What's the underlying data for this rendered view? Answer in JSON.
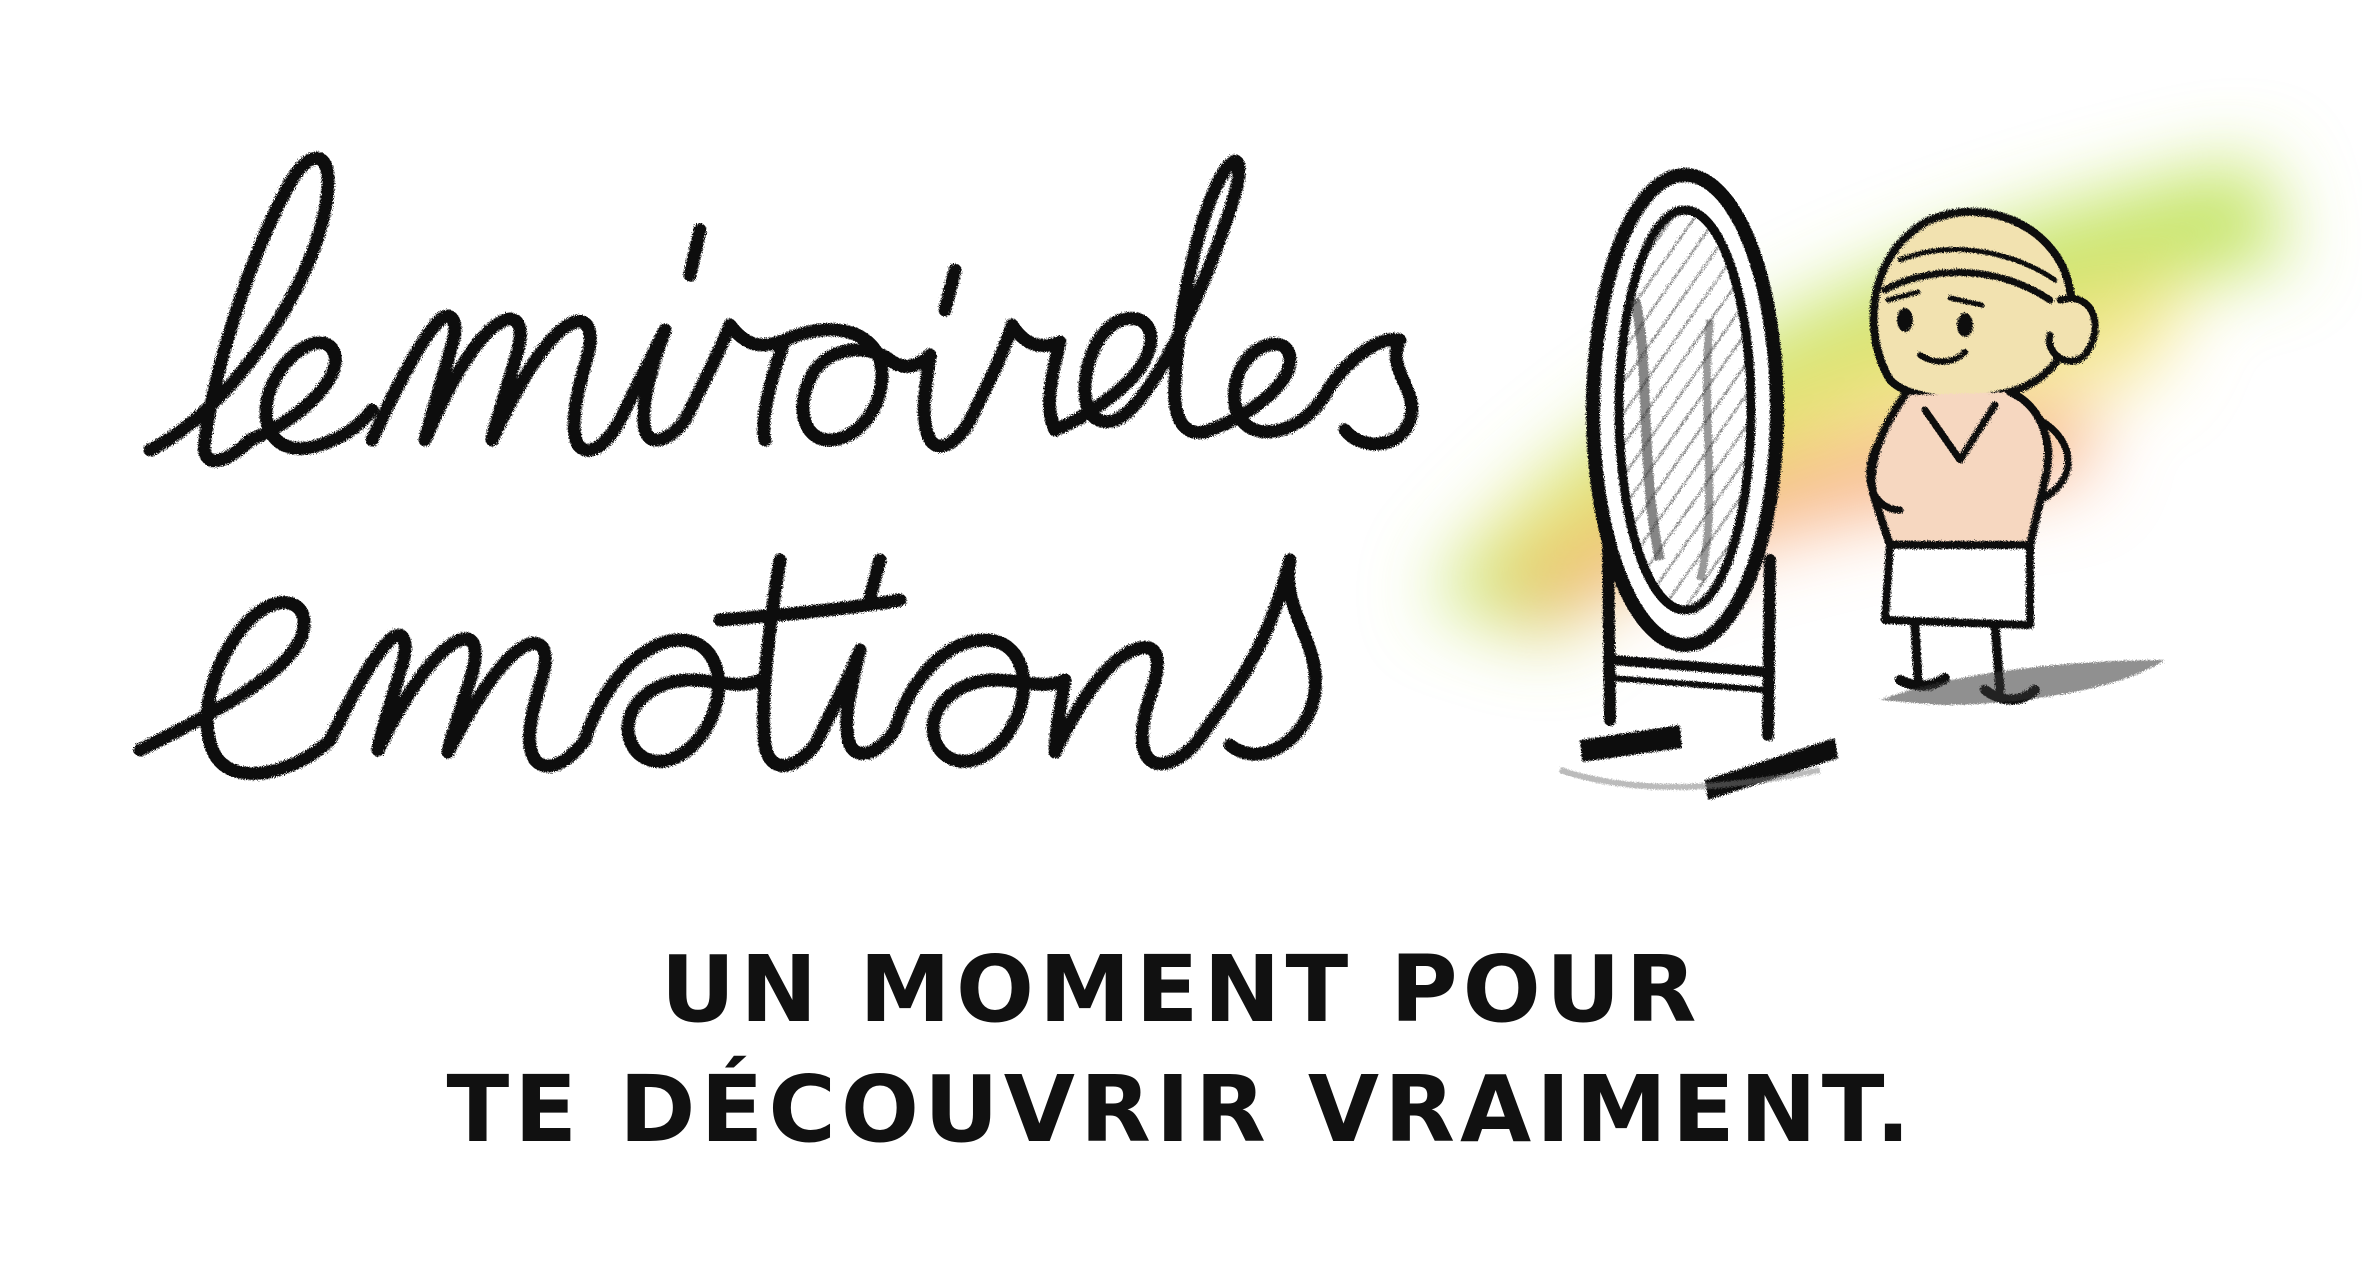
{
  "logo": {
    "title_line_1": "le miroir des",
    "title_line_2": "emotions"
  },
  "tagline": {
    "line_1": "UN MOMENT POUR",
    "line_2": "TE DÉCOUVRIR VRAIMENT."
  },
  "colors": {
    "background": "#ffffff",
    "ink": "#111111",
    "glow_green": "#b8e04a",
    "glow_yellow": "#f3e27a",
    "glow_orange": "#f6a06a",
    "skin": "#f2e2b0"
  },
  "icons": {
    "mirror": "standing-oval-mirror",
    "child": "child-figure"
  }
}
